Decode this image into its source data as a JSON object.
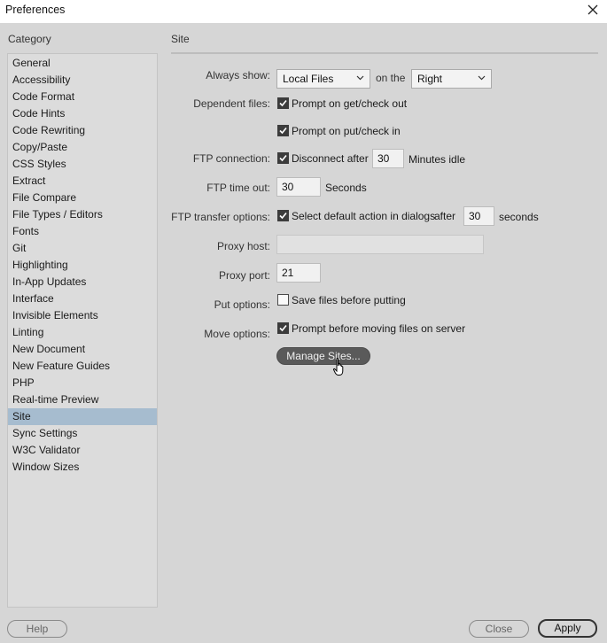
{
  "window": {
    "title": "Preferences"
  },
  "category": {
    "title": "Category",
    "items": [
      "General",
      "Accessibility",
      "Code Format",
      "Code Hints",
      "Code Rewriting",
      "Copy/Paste",
      "CSS Styles",
      "Extract",
      "File Compare",
      "File Types / Editors",
      "Fonts",
      "Git",
      "Highlighting",
      "In-App Updates",
      "Interface",
      "Invisible Elements",
      "Linting",
      "New Document",
      "New Feature Guides",
      "PHP",
      "Real-time Preview",
      "Site",
      "Sync Settings",
      "W3C Validator",
      "Window Sizes"
    ],
    "selected": "Site"
  },
  "site": {
    "title": "Site",
    "always_show_label": "Always show:",
    "always_show_value": "Local Files",
    "on_the_label": "on the",
    "side_value": "Right",
    "dependent_files_label": "Dependent files:",
    "prompt_get_label": "Prompt on get/check out",
    "prompt_put_label": "Prompt on put/check in",
    "ftp_connection_label": "FTP connection:",
    "disconnect_label": "Disconnect after",
    "disconnect_minutes": "30",
    "minutes_idle_label": "Minutes idle",
    "ftp_timeout_label": "FTP time out:",
    "ftp_timeout_value": "30",
    "seconds_label": "Seconds",
    "ftp_transfer_label": "FTP transfer options:",
    "select_default_label": "Select default action in dialogs",
    "after_label": "after",
    "transfer_seconds": "30",
    "seconds_lower_label": "seconds",
    "proxy_host_label": "Proxy host:",
    "proxy_host_value": "",
    "proxy_port_label": "Proxy port:",
    "proxy_port_value": "21",
    "put_options_label": "Put options:",
    "save_before_put_label": "Save files before putting",
    "move_options_label": "Move options:",
    "prompt_move_label": "Prompt before moving files on server",
    "manage_sites_label": "Manage Sites..."
  },
  "checkboxes": {
    "prompt_get": true,
    "prompt_put": true,
    "disconnect": true,
    "select_default": true,
    "save_before_put": false,
    "prompt_move": true
  },
  "footer": {
    "help": "Help",
    "close": "Close",
    "apply": "Apply"
  }
}
